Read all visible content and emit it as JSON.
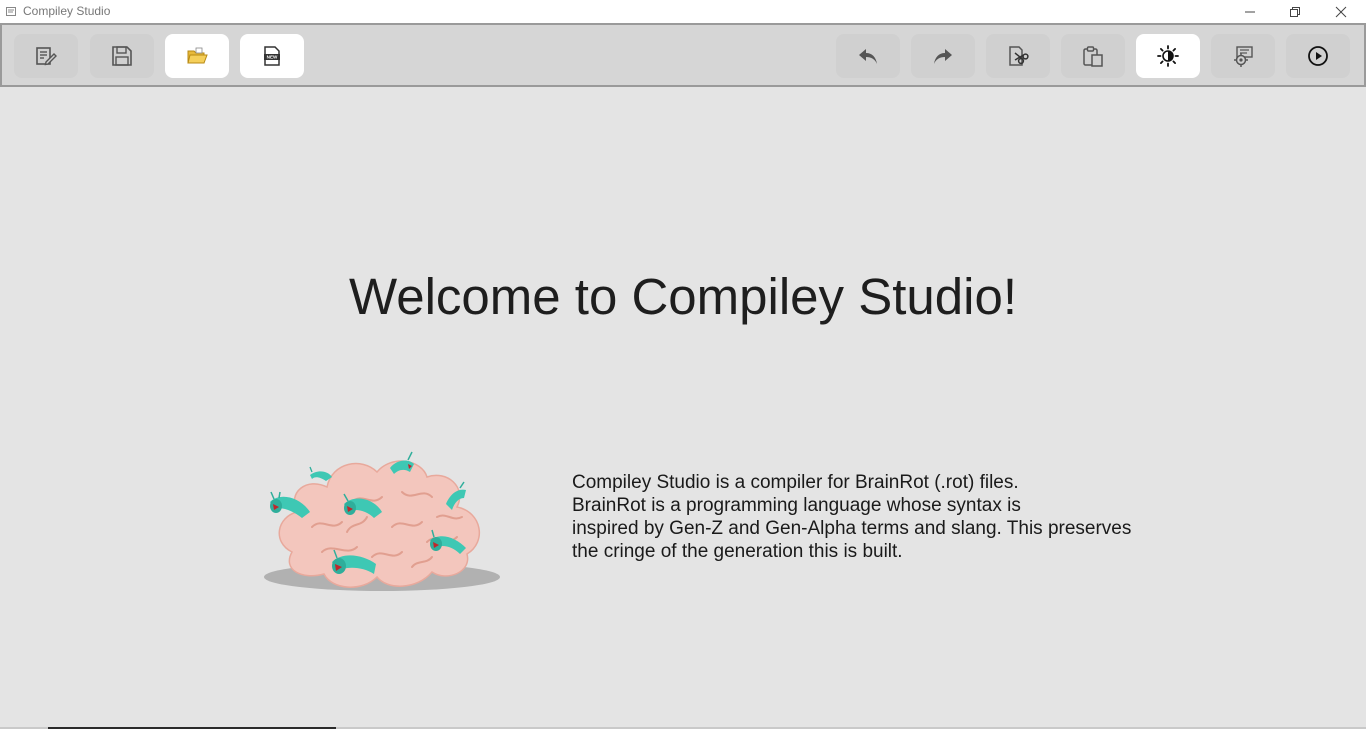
{
  "window": {
    "title": "Compiley Studio",
    "controls": [
      "minimize-icon",
      "restore-icon",
      "close-icon"
    ]
  },
  "toolbar": {
    "left_buttons": [
      {
        "name": "edit-document-icon",
        "active": false
      },
      {
        "name": "save-icon",
        "active": false
      },
      {
        "name": "open-folder-icon",
        "active": true
      },
      {
        "name": "new-file-icon",
        "active": true,
        "badge": "NEW"
      }
    ],
    "right_buttons": [
      {
        "name": "undo-icon",
        "active": false
      },
      {
        "name": "redo-icon",
        "active": false
      },
      {
        "name": "cut-icon",
        "active": false
      },
      {
        "name": "paste-icon",
        "active": false
      },
      {
        "name": "theme-toggle-icon",
        "active": true
      },
      {
        "name": "compile-icon",
        "active": false
      },
      {
        "name": "run-icon",
        "active": false
      }
    ]
  },
  "main": {
    "heading": "Welcome to Compiley Studio!",
    "description": [
      "Compiley Studio is a compiler for BrainRot (.rot) files.",
      "BrainRot is a programming language whose syntax is",
      "inspired by Gen-Z and Gen-Alpha terms and slang. This preserves",
      "the cringe of the generation this is built."
    ]
  },
  "colors": {
    "background": "#e4e4e4",
    "toolbar": "#d6d6d6",
    "active_button": "#ffffff",
    "brain": "#f3c6bd",
    "worm": "#3ec8b4"
  }
}
